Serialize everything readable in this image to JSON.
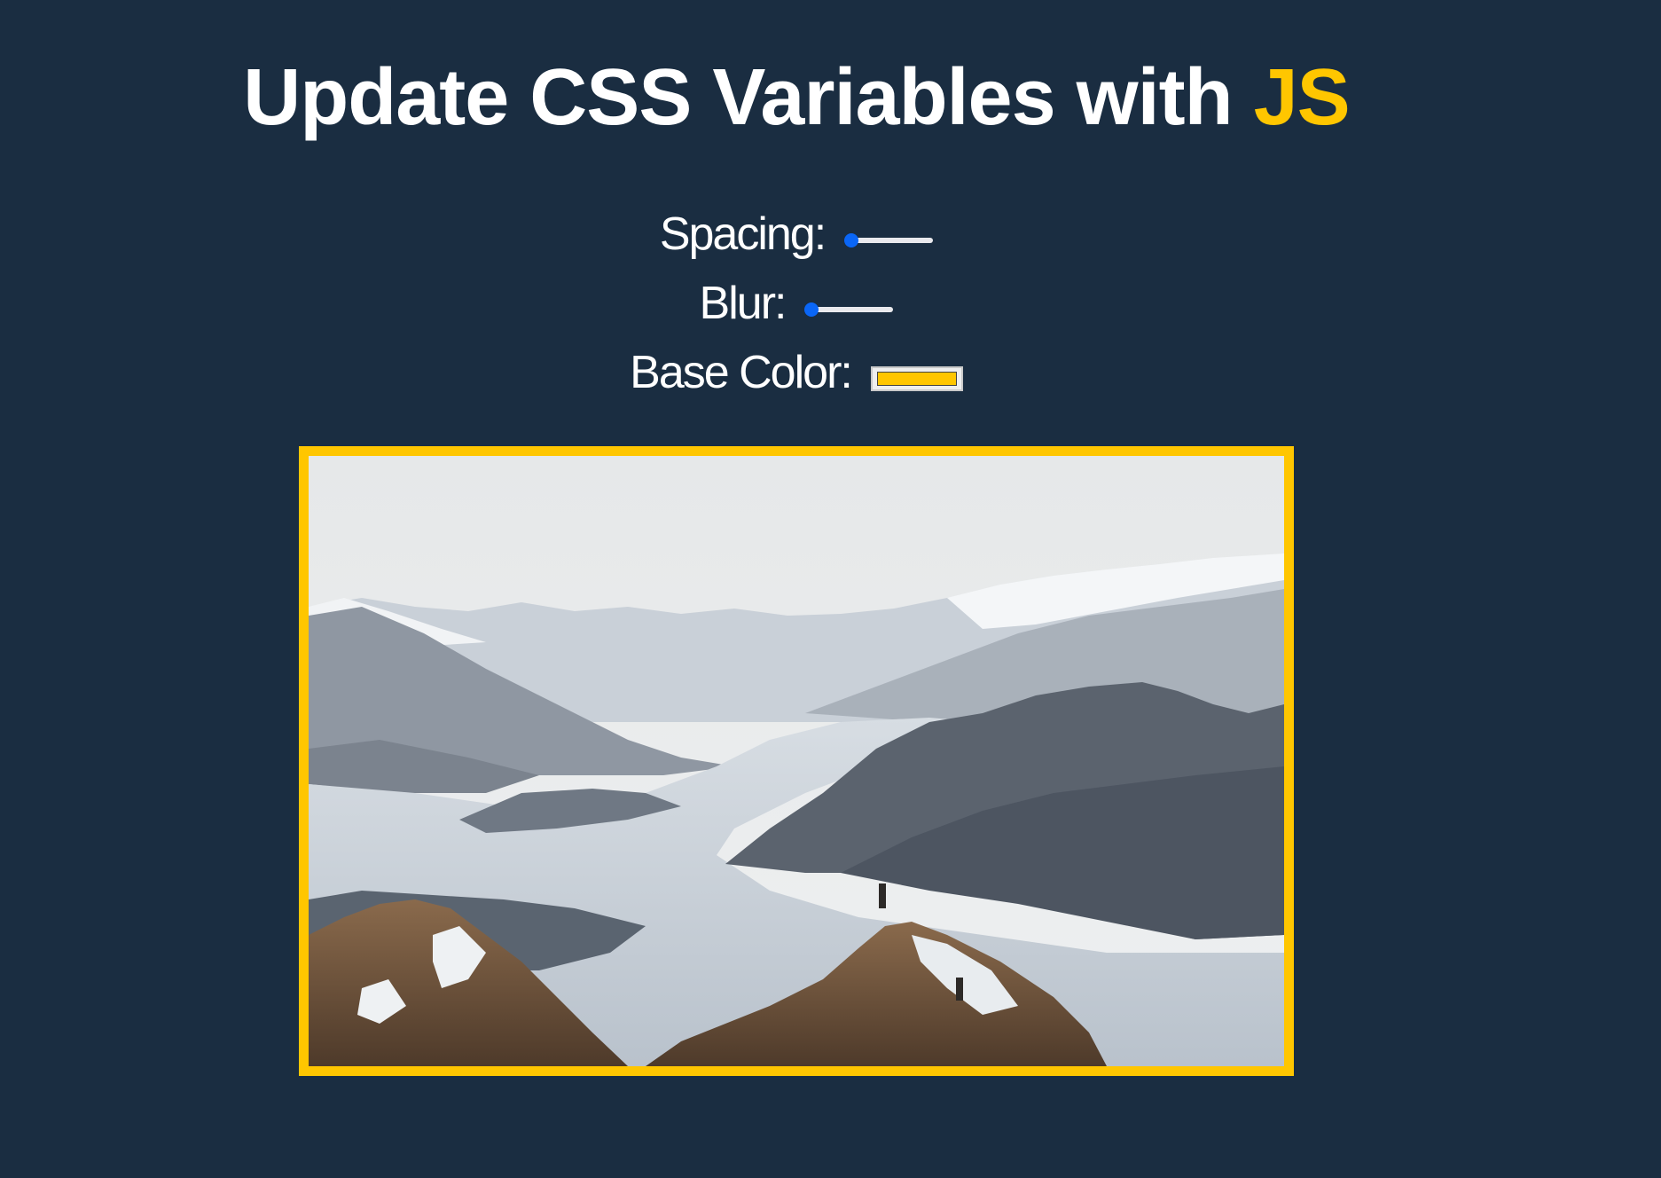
{
  "header": {
    "title_prefix": "Update CSS Variables with ",
    "title_highlight": "JS"
  },
  "controls": {
    "spacing_label": "Spacing:",
    "spacing_value": 0,
    "blur_label": "Blur:",
    "blur_value": 0,
    "base_color_label": "Base Color:",
    "base_color_value": "#ffc600"
  },
  "colors": {
    "background": "#1a2d41",
    "accent": "#ffc600",
    "slider_thumb": "#0a66f6"
  },
  "image": {
    "subject": "mountain-lake-landscape-photo"
  }
}
